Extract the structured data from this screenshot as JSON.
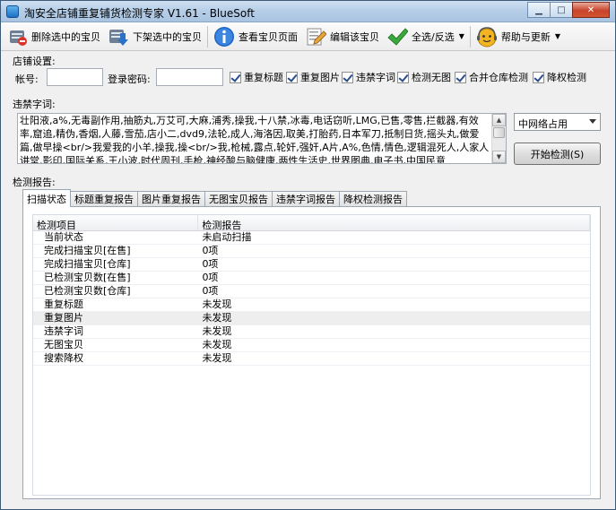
{
  "window": {
    "title": "淘安全店铺重复铺货检测专家 V1.61  -  BlueSoft"
  },
  "toolbar": {
    "delete_selected": "删除选中的宝贝",
    "delist_selected": "下架选中的宝贝",
    "view_item_page": "查看宝贝页面",
    "edit_item": "编辑该宝贝",
    "select_all_toggle": "全选/反选",
    "help_update": "帮助与更新"
  },
  "shop_settings": {
    "label": "店铺设置:",
    "account_label": "帐号:",
    "account_value": "",
    "password_label": "登录密码:",
    "password_value": "",
    "checks": [
      {
        "label": "重复标题",
        "checked": true
      },
      {
        "label": "重复图片",
        "checked": true
      },
      {
        "label": "违禁字词",
        "checked": true
      },
      {
        "label": "检测无图",
        "checked": true
      },
      {
        "label": "合并仓库检测",
        "checked": true
      },
      {
        "label": "降权检测",
        "checked": true
      }
    ]
  },
  "banned_words": {
    "label": "违禁字词:",
    "text": "壮阳液,a%,无毒副作用,抽筋丸,万艾可,大麻,浦秀,操我,十八禁,冰毒,电话窃听,LMG,已售,零售,拦截器,有效率,窟追,精伪,香烟,人藤,雪茄,店小二,dvd9,法轮,成人,海洛因,取美,打胎药,日本军刀,抵制日货,摇头丸,做爱篇,做早操<br/>我爱我的小羊,操我,操<br/>我,枪械,露点,轮奸,强奸,A片,A%,色情,情色,逻辑混死人,人家人讲堂,影印,国际关系,王小波,时代周刊,手枪,神经酸与脑健康,两性生活史,世界图典,电子书,中国民意",
    "mode_select": "中网络占用",
    "start_button": "开始检测(S)"
  },
  "report": {
    "label": "检测报告:",
    "tabs": [
      "扫描状态",
      "标题重复报告",
      "图片重复报告",
      "无图宝贝报告",
      "违禁字词报告",
      "降权检测报告"
    ],
    "columns": [
      "检测项目",
      "检测报告"
    ],
    "rows": [
      {
        "item": "当前状态",
        "result": "未启动扫描"
      },
      {
        "item": "完成扫描宝贝[在售]",
        "result": "0项"
      },
      {
        "item": "完成扫描宝贝[仓库]",
        "result": "0项"
      },
      {
        "item": "已检测宝贝数[在售]",
        "result": "0项"
      },
      {
        "item": "已检测宝贝数[仓库]",
        "result": "0项"
      },
      {
        "item": "重复标题",
        "result": "未发现"
      },
      {
        "item": "重复图片",
        "result": "未发现"
      },
      {
        "item": "违禁字词",
        "result": "未发现"
      },
      {
        "item": "无图宝贝",
        "result": "未发现"
      },
      {
        "item": "搜索降权",
        "result": "未发现"
      }
    ]
  }
}
